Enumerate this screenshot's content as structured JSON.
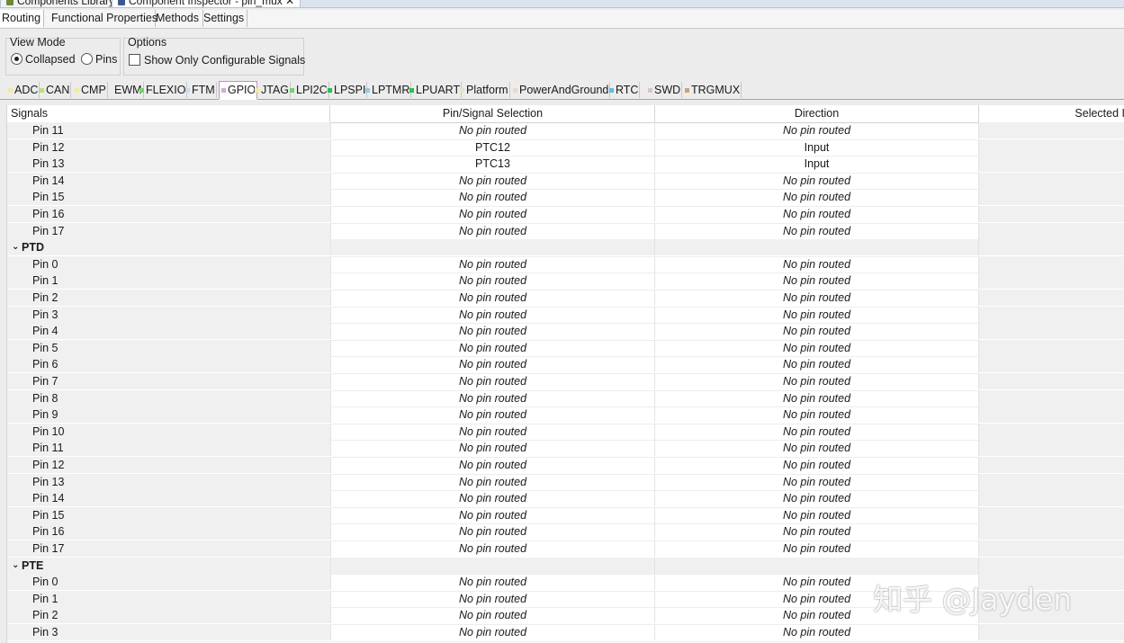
{
  "top_tabs": [
    {
      "label": "Components Library"
    },
    {
      "label": "Component Inspector - pin_mux ✕"
    }
  ],
  "sub_tabs": [
    "Routing",
    "Functional Properties",
    "Methods",
    "Settings"
  ],
  "view_mode": {
    "title": "View Mode",
    "collapsed": "Collapsed",
    "pins": "Pins"
  },
  "options": {
    "title": "Options",
    "show_only": "Show Only Configurable Signals"
  },
  "peripheral_tabs": [
    {
      "label": "ADC",
      "color": "#f2eaa0"
    },
    {
      "label": "CAN",
      "color": "#b8e36d"
    },
    {
      "label": "CMP",
      "color": "#f2eaa0"
    },
    {
      "label": "EWM",
      "color": "#ececec"
    },
    {
      "label": "FLEXIO",
      "color": "#74d36e"
    },
    {
      "label": "FTM",
      "color": "#c9dcef"
    },
    {
      "label": "GPIO",
      "color": "#d7a9d9"
    },
    {
      "label": "JTAG",
      "color": "#f2eaa0"
    },
    {
      "label": "LPI2C",
      "color": "#74d36e"
    },
    {
      "label": "LPSPI",
      "color": "#2ebf4d"
    },
    {
      "label": "LPTMR",
      "color": "#8ecde8"
    },
    {
      "label": "LPUART",
      "color": "#2ebf4d"
    },
    {
      "label": "Platform",
      "color": "#e9e1c9"
    },
    {
      "label": "PowerAndGround",
      "color": "#e9d9c9"
    },
    {
      "label": "RTC",
      "color": "#5dbbe6"
    },
    {
      "label": "SWD",
      "color": "#d9c4c4"
    },
    {
      "label": "TRGMUX",
      "color": "#c9a37b"
    }
  ],
  "columns": [
    "Signals",
    "Pin/Signal Selection",
    "Direction",
    "Selected I"
  ],
  "rows": [
    {
      "signal": "Pin 11",
      "pin": "No pin routed",
      "dir": "No pin routed"
    },
    {
      "signal": "Pin 12",
      "pin": "PTC12",
      "dir": "Input"
    },
    {
      "signal": "Pin 13",
      "pin": "PTC13",
      "dir": "Input"
    },
    {
      "signal": "Pin 14",
      "pin": "No pin routed",
      "dir": "No pin routed"
    },
    {
      "signal": "Pin 15",
      "pin": "No pin routed",
      "dir": "No pin routed"
    },
    {
      "signal": "Pin 16",
      "pin": "No pin routed",
      "dir": "No pin routed"
    },
    {
      "signal": "Pin 17",
      "pin": "No pin routed",
      "dir": "No pin routed"
    },
    {
      "group": "PTD"
    },
    {
      "signal": "Pin 0",
      "pin": "No pin routed",
      "dir": "No pin routed"
    },
    {
      "signal": "Pin 1",
      "pin": "No pin routed",
      "dir": "No pin routed"
    },
    {
      "signal": "Pin 2",
      "pin": "No pin routed",
      "dir": "No pin routed"
    },
    {
      "signal": "Pin 3",
      "pin": "No pin routed",
      "dir": "No pin routed"
    },
    {
      "signal": "Pin 4",
      "pin": "No pin routed",
      "dir": "No pin routed"
    },
    {
      "signal": "Pin 5",
      "pin": "No pin routed",
      "dir": "No pin routed"
    },
    {
      "signal": "Pin 6",
      "pin": "No pin routed",
      "dir": "No pin routed"
    },
    {
      "signal": "Pin 7",
      "pin": "No pin routed",
      "dir": "No pin routed"
    },
    {
      "signal": "Pin 8",
      "pin": "No pin routed",
      "dir": "No pin routed"
    },
    {
      "signal": "Pin 9",
      "pin": "No pin routed",
      "dir": "No pin routed"
    },
    {
      "signal": "Pin 10",
      "pin": "No pin routed",
      "dir": "No pin routed"
    },
    {
      "signal": "Pin 11",
      "pin": "No pin routed",
      "dir": "No pin routed"
    },
    {
      "signal": "Pin 12",
      "pin": "No pin routed",
      "dir": "No pin routed"
    },
    {
      "signal": "Pin 13",
      "pin": "No pin routed",
      "dir": "No pin routed"
    },
    {
      "signal": "Pin 14",
      "pin": "No pin routed",
      "dir": "No pin routed"
    },
    {
      "signal": "Pin 15",
      "pin": "No pin routed",
      "dir": "No pin routed"
    },
    {
      "signal": "Pin 16",
      "pin": "No pin routed",
      "dir": "No pin routed"
    },
    {
      "signal": "Pin 17",
      "pin": "No pin routed",
      "dir": "No pin routed"
    },
    {
      "group": "PTE"
    },
    {
      "signal": "Pin 0",
      "pin": "No pin routed",
      "dir": "No pin routed"
    },
    {
      "signal": "Pin 1",
      "pin": "No pin routed",
      "dir": "No pin routed"
    },
    {
      "signal": "Pin 2",
      "pin": "No pin routed",
      "dir": "No pin routed"
    },
    {
      "signal": "Pin 3",
      "pin": "No pin routed",
      "dir": "No pin routed"
    }
  ],
  "watermark": "知乎 @Jayden"
}
